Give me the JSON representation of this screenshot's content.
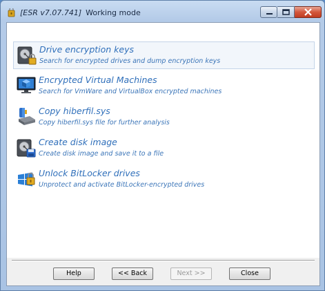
{
  "window": {
    "title": "[ESR v7.07.741]",
    "subtitle": "Working mode"
  },
  "options": [
    {
      "title": "Drive encryption keys",
      "desc": "Search for encrypted drives and dump encryption keys",
      "icon": "drive-lock-icon",
      "selected": true
    },
    {
      "title": "Encrypted Virtual Machines",
      "desc": "Search for VmWare and VirtualBox encrypted machines",
      "icon": "virtual-machine-icon",
      "selected": false
    },
    {
      "title": "Copy hiberfil.sys",
      "desc": "Copy hiberfil.sys file for further analysis",
      "icon": "hibernate-file-icon",
      "selected": false
    },
    {
      "title": "Create disk image",
      "desc": "Create disk image and save it to a file",
      "icon": "disk-image-icon",
      "selected": false
    },
    {
      "title": "Unlock BitLocker drives",
      "desc": "Unprotect and activate BitLocker-encrypted drives",
      "icon": "bitlocker-unlock-icon",
      "selected": false
    }
  ],
  "buttons": {
    "help": "Help",
    "back": "<< Back",
    "next": "Next >>",
    "close": "Close"
  },
  "colors": {
    "option_title": "#2f6fba",
    "option_desc": "#3b75b8",
    "desktop": "#5a8cc8"
  }
}
